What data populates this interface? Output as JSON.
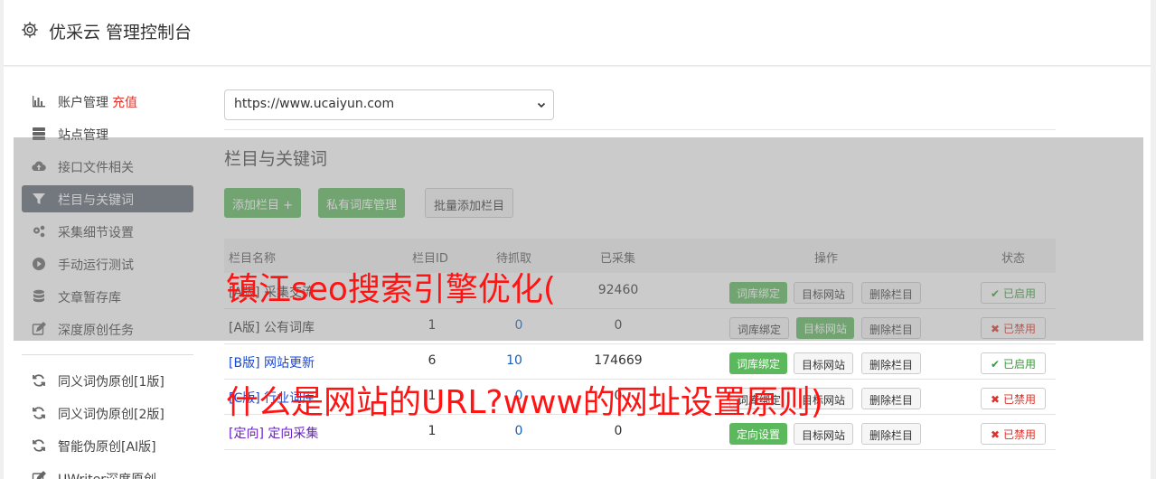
{
  "app": {
    "title": "优采云 管理控制台"
  },
  "sidebar": {
    "items": [
      {
        "label": "账户管理",
        "extra": "充值",
        "icon": "bar-chart-icon"
      },
      {
        "label": "站点管理",
        "icon": "server-icon"
      },
      {
        "label": "接口文件相关",
        "icon": "cloud-upload-icon"
      },
      {
        "label": "栏目与关键词",
        "icon": "filter-icon"
      },
      {
        "label": "采集细节设置",
        "icon": "gears-icon"
      },
      {
        "label": "手动运行测试",
        "icon": "play-circle-icon"
      },
      {
        "label": "文章暂存库",
        "icon": "database-icon"
      },
      {
        "label": "深度原创任务",
        "icon": "edit-icon"
      },
      {
        "label": "同义词伪原创[1版]",
        "icon": "refresh-icon"
      },
      {
        "label": "同义词伪原创[2版]",
        "icon": "refresh-icon"
      },
      {
        "label": "智能伪原创[AI版]",
        "icon": "refresh-icon"
      },
      {
        "label": "UWriter深度原创",
        "icon": "edit-icon"
      }
    ],
    "active_index": 3
  },
  "site_select": {
    "value": "https://www.ucaiyun.com"
  },
  "section": {
    "title": "栏目与关键词"
  },
  "toolbar": {
    "add_label": "添加栏目 +",
    "private_lib_label": "私有词库管理",
    "batch_add_label": "批量添加栏目"
  },
  "table": {
    "headers": [
      "栏目名称",
      "栏目ID",
      "待抓取",
      "已采集",
      "操作",
      "状态"
    ],
    "rows": [
      {
        "prefix": "[A版]",
        "name": "采集交流",
        "id": "",
        "pending": "",
        "collected": "92460",
        "action1": "词库绑定",
        "action2": "目标网站",
        "action3": "删除栏目",
        "status": "已启用",
        "enabled": true
      },
      {
        "prefix": "[A版]",
        "name": "公有词库",
        "id": "1",
        "pending": "0",
        "collected": "0",
        "action1": "词库绑定",
        "action2": "目标网站",
        "action3": "删除栏目",
        "status": "已禁用",
        "enabled": false
      },
      {
        "prefix": "[B版]",
        "name": "网站更新",
        "id": "6",
        "pending": "10",
        "collected": "174669",
        "action1": "词库绑定",
        "action2": "目标网站",
        "action3": "删除栏目",
        "status": "已启用",
        "enabled": true
      },
      {
        "prefix": "[C版]",
        "name": "行业词库",
        "id": "1",
        "pending": "0",
        "collected": "0",
        "action1": "词库绑定",
        "action2": "目标网站",
        "action3": "删除栏目",
        "status": "已禁用",
        "enabled": false
      },
      {
        "prefix": "[定向]",
        "name": "定向采集",
        "id": "1",
        "pending": "0",
        "collected": "0",
        "action1": "定向设置",
        "action2": "目标网站",
        "action3": "删除栏目",
        "status": "已禁用",
        "enabled": false
      }
    ]
  },
  "watermarks": {
    "line1": "镇江seo搜索引擎优化(",
    "line2": "什么是网站的URL?www的网址设置原则)"
  },
  "colors": {
    "primary_green": "#5cb85c",
    "active_sidebar": "#5f6875",
    "watermark_red": "#ff1414"
  }
}
